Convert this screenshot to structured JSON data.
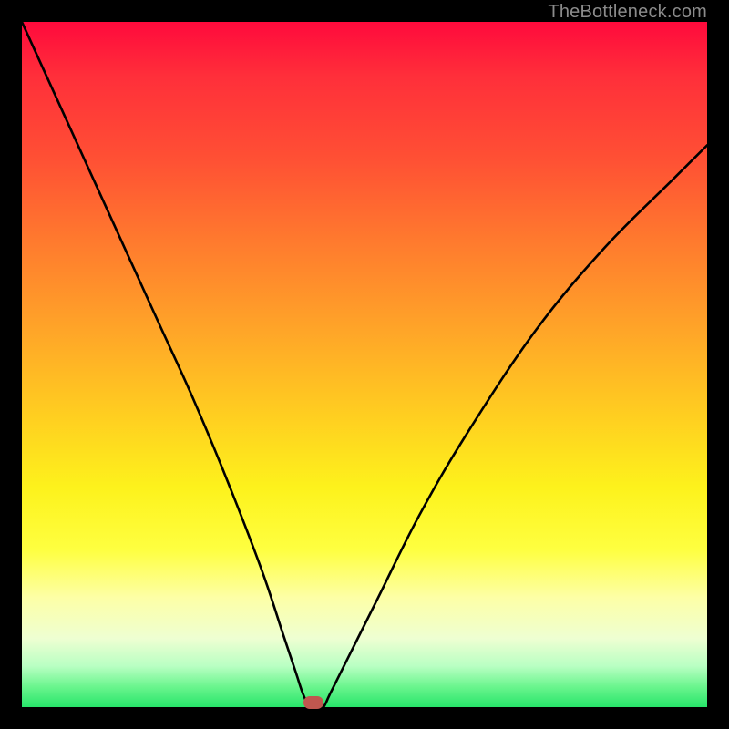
{
  "watermark": "TheBottleneck.com",
  "chart_data": {
    "type": "line",
    "title": "",
    "xlabel": "",
    "ylabel": "",
    "xlim": [
      0,
      100
    ],
    "ylim": [
      0,
      100
    ],
    "series": [
      {
        "name": "curve",
        "x": [
          0,
          5,
          10,
          15,
          20,
          25,
          30,
          35,
          38,
          40,
          41,
          42,
          43,
          44,
          45,
          48,
          52,
          58,
          65,
          75,
          85,
          95,
          100
        ],
        "values": [
          100,
          89,
          78,
          67,
          56,
          45,
          33,
          20,
          11,
          5,
          2,
          0,
          0,
          0,
          2,
          8,
          16,
          28,
          40,
          55,
          67,
          77,
          82
        ]
      }
    ],
    "marker": {
      "x": 42.5,
      "y": 0.7
    },
    "background_gradient": {
      "top": "#ff0a3c",
      "mid": "#fdf21c",
      "bottom": "#27e56a"
    }
  }
}
